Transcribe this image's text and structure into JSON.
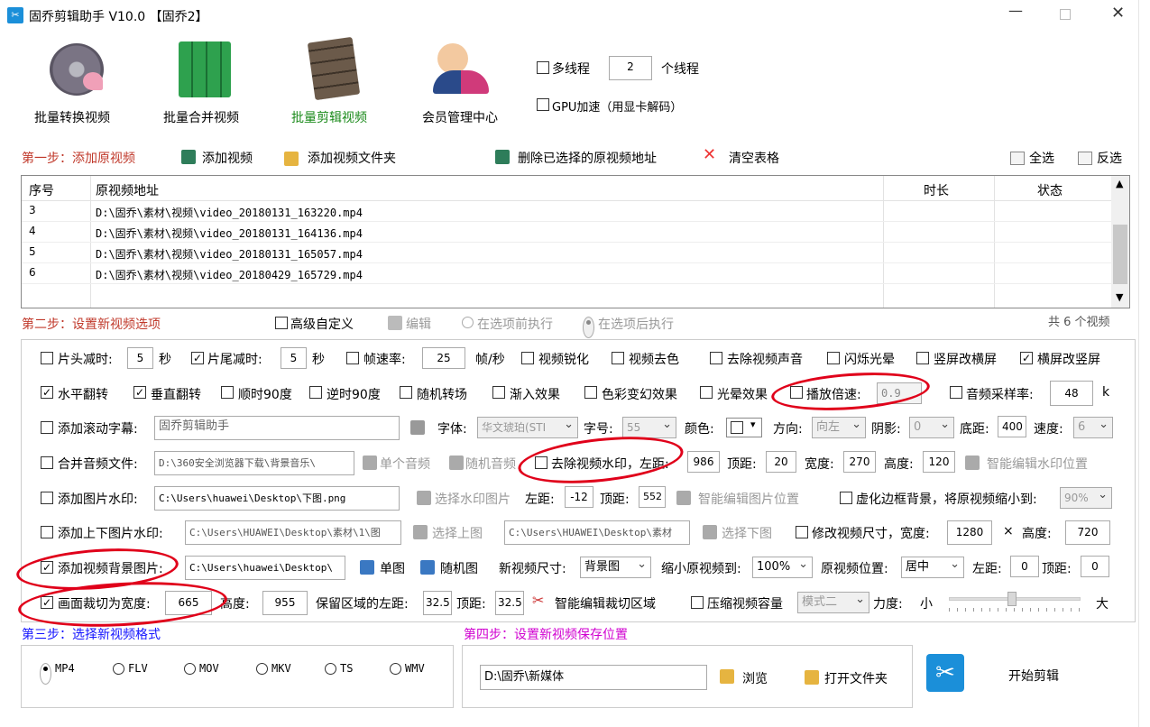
{
  "window": {
    "title": "固乔剪辑助手 V10.0 【固乔2】"
  },
  "tools": [
    {
      "label": "批量转换视频"
    },
    {
      "label": "批量合并视频"
    },
    {
      "label": "批量剪辑视频"
    },
    {
      "label": "会员管理中心"
    }
  ],
  "thread": {
    "label": "多线程",
    "value": "2",
    "suffix": "个线程",
    "gpu": "GPU加速（用显卡解码）"
  },
  "step1": {
    "title": "第一步：添加原视频",
    "add_video": "添加视频",
    "add_folder": "添加视频文件夹",
    "delete": "删除已选择的原视频地址",
    "clear": "清空表格",
    "select_all": "全选",
    "invert": "反选"
  },
  "table": {
    "headers": [
      "序号",
      "原视频地址",
      "时长",
      "状态"
    ],
    "rows": [
      {
        "n": "3",
        "path": "D:\\固乔\\素材\\视频\\video_20180131_163220.mp4"
      },
      {
        "n": "4",
        "path": "D:\\固乔\\素材\\视频\\video_20180131_164136.mp4"
      },
      {
        "n": "5",
        "path": "D:\\固乔\\素材\\视频\\video_20180131_165057.mp4"
      },
      {
        "n": "6",
        "path": "D:\\固乔\\素材\\视频\\video_20180429_165729.mp4"
      }
    ]
  },
  "step2": {
    "title": "第二步：设置新视频选项",
    "advanced": "高级自定义",
    "edit": "编辑",
    "before": "在选项前执行",
    "after": "在选项后执行",
    "count": "共 6 个视频"
  },
  "opt": {
    "head_cut": "片头减时:",
    "head_val": "5",
    "sec1": "秒",
    "tail_cut": "片尾减时:",
    "tail_val": "5",
    "sec2": "秒",
    "fps": "帧速率:",
    "fps_val": "25",
    "fps_unit": "帧/秒",
    "sharpen": "视频锐化",
    "decolor": "视频去色",
    "mute": "去除视频声音",
    "flash": "闪烁光晕",
    "v2h": "竖屏改横屏",
    "h2v": "横屏改竖屏",
    "hflip": "水平翻转",
    "vflip": "垂直翻转",
    "cw90": "顺时90度",
    "ccw90": "逆时90度",
    "rand_trans": "随机转场",
    "fadein": "渐入效果",
    "color_fx": "色彩变幻效果",
    "halo": "光晕效果",
    "speed": "播放倍速:",
    "speed_val": "0.9",
    "sample": "音频采样率:",
    "sample_val": "48",
    "sample_unit": "k",
    "scroll": "添加滚动字幕:",
    "scroll_val": "固乔剪辑助手",
    "font": "字体:",
    "font_val": "华文琥珀(STI",
    "size": "字号:",
    "size_val": "55",
    "color": "颜色:",
    "dir": "方向:",
    "dir_val": "向左",
    "shadow": "阴影:",
    "shadow_val": "0",
    "bottom": "底距:",
    "bottom_val": "400",
    "spd": "速度:",
    "spd_val": "6",
    "merge_audio": "合并音频文件:",
    "merge_audio_val": "D:\\360安全浏览器下载\\背景音乐\\",
    "single_audio": "单个音频",
    "rand_audio": "随机音频",
    "rm_wm": "去除视频水印，左距:",
    "rm_left": "986",
    "rm_top_lbl": "顶距:",
    "rm_top": "20",
    "rm_w_lbl": "宽度:",
    "rm_w": "270",
    "rm_h_lbl": "高度:",
    "rm_h": "120",
    "smart_wm": "智能编辑水印位置",
    "img_wm": "添加图片水印:",
    "img_wm_val": "C:\\Users\\huawei\\Desktop\\下图.png",
    "sel_wm": "选择水印图片",
    "left": "左距:",
    "img_left": "-12",
    "top": "顶距:",
    "img_top": "552",
    "smart_img": "智能编辑图片位置",
    "blur_bg": "虚化边框背景，将原视频缩小到:",
    "blur_val": "90%",
    "tb_img": "添加上下图片水印:",
    "tb_up": "C:\\Users\\HUAWEI\\Desktop\\素材\\1\\图",
    "sel_up": "选择上图",
    "tb_down": "C:\\Users\\HUAWEI\\Desktop\\素材",
    "sel_down": "选择下图",
    "resize": "修改视频尺寸，宽度:",
    "resize_w": "1280",
    "times": "×",
    "h": "高度:",
    "resize_h": "720",
    "bg_img": "添加视频背景图片:",
    "bg_val": "C:\\Users\\huawei\\Desktop\\",
    "single_img": "单图",
    "rand_img": "随机图",
    "new_size": "新视频尺寸:",
    "new_size_val": "背景图",
    "shrink": "缩小原视频到:",
    "shrink_val": "100%",
    "pos": "原视频位置:",
    "pos_val": "居中",
    "bg_left": "0",
    "bg_top": "0",
    "crop": "画面裁切为宽度:",
    "crop_w": "665",
    "crop_h_lbl": "高度:",
    "crop_h": "955",
    "keep": "保留区域的左距:",
    "keep_left": "32.5",
    "keep_top_lbl": "顶距:",
    "keep_top": "32.5",
    "smart_crop": "智能编辑裁切区域",
    "compress": "压缩视频容量",
    "mode": "模式二",
    "force": "力度:",
    "small": "小",
    "big": "大"
  },
  "step3": {
    "title": "第三步：选择新视频格式",
    "formats": [
      "MP4",
      "FLV",
      "MOV",
      "MKV",
      "TS",
      "WMV"
    ]
  },
  "step4": {
    "title": "第四步：设置新视频保存位置",
    "path": "D:\\固乔\\新媒体",
    "browse": "浏览",
    "open": "打开文件夹"
  },
  "start": "开始剪辑",
  "colors": {
    "step_red": "#c0392b",
    "step3_blue": "#1414ff",
    "step4_magenta": "#d000d0",
    "annotation": "#e0001a"
  }
}
